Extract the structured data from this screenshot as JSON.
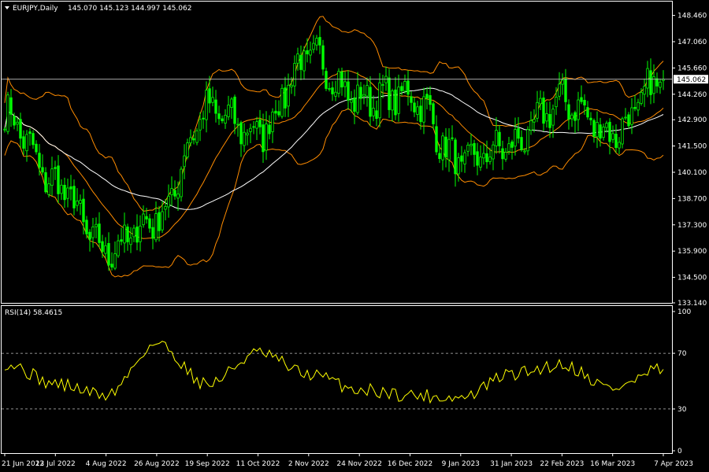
{
  "header": {
    "symbol": "EURJPY,Daily",
    "ohlc": "145.070 145.123 144.997 145.062"
  },
  "rsi_header": "RSI(14) 58.4615",
  "colors": {
    "background": "#000000",
    "candle": "#00ff00",
    "bollinger": "#ff8c00",
    "ma": "#ffffff",
    "rsi": "#ffff00",
    "frame": "#ffffff"
  },
  "chart_data": [
    {
      "type": "candlestick",
      "title": "EURJPY,Daily",
      "price_ticks": [
        "148.460",
        "147.060",
        "145.660",
        "144.260",
        "142.900",
        "141.500",
        "140.100",
        "138.700",
        "137.300",
        "135.900",
        "134.500",
        "133.140"
      ],
      "current_price": "145.062",
      "ylim": [
        133.14,
        149.2
      ],
      "x_tick_labels": [
        "21 Jun 2022",
        "13 Jul 2022",
        "4 Aug 2022",
        "26 Aug 2022",
        "19 Sep 2022",
        "11 Oct 2022",
        "2 Nov 2022",
        "24 Nov 2022",
        "16 Dec 2022",
        "9 Jan 2023",
        "31 Jan 2023",
        "22 Feb 2023",
        "16 Mar 2023",
        "7 Apr 2023"
      ],
      "close_anchors": [
        [
          "21 Jun 2022",
          143.2
        ],
        [
          "13 Jul 2022",
          139.5
        ],
        [
          "4 Aug 2022",
          135.9
        ],
        [
          "26 Aug 2022",
          137.6
        ],
        [
          "19 Sep 2022",
          143.4
        ],
        [
          "11 Oct 2022",
          142.2
        ],
        [
          "2 Nov 2022",
          146.3
        ],
        [
          "24 Nov 2022",
          144.0
        ],
        [
          "16 Dec 2022",
          144.2
        ],
        [
          "9 Jan 2023",
          140.6
        ],
        [
          "31 Jan 2023",
          141.5
        ],
        [
          "22 Feb 2023",
          143.9
        ],
        [
          "16 Mar 2023",
          142.2
        ],
        [
          "7 Apr 2023",
          145.062
        ]
      ],
      "series": [
        "Bollinger Bands upper",
        "Bollinger Bands middle",
        "Bollinger Bands lower",
        "Moving average"
      ]
    },
    {
      "type": "line",
      "title": "RSI(14) 58.4615",
      "yticks": [
        "100",
        "70",
        "30",
        "0"
      ],
      "levels": [
        70,
        30
      ],
      "ylim": [
        0,
        100
      ],
      "rsi_anchors": [
        [
          "21 Jun 2022",
          63
        ],
        [
          "13 Jul 2022",
          48
        ],
        [
          "4 Aug 2022",
          40
        ],
        [
          "26 Aug 2022",
          77
        ],
        [
          "19 Sep 2022",
          48
        ],
        [
          "11 Oct 2022",
          70
        ],
        [
          "2 Nov 2022",
          55
        ],
        [
          "24 Nov 2022",
          44
        ],
        [
          "16 Dec 2022",
          40
        ],
        [
          "9 Jan 2023",
          38
        ],
        [
          "31 Jan 2023",
          55
        ],
        [
          "22 Feb 2023",
          62
        ],
        [
          "16 Mar 2023",
          45
        ],
        [
          "7 Apr 2023",
          58.4615
        ]
      ]
    }
  ]
}
